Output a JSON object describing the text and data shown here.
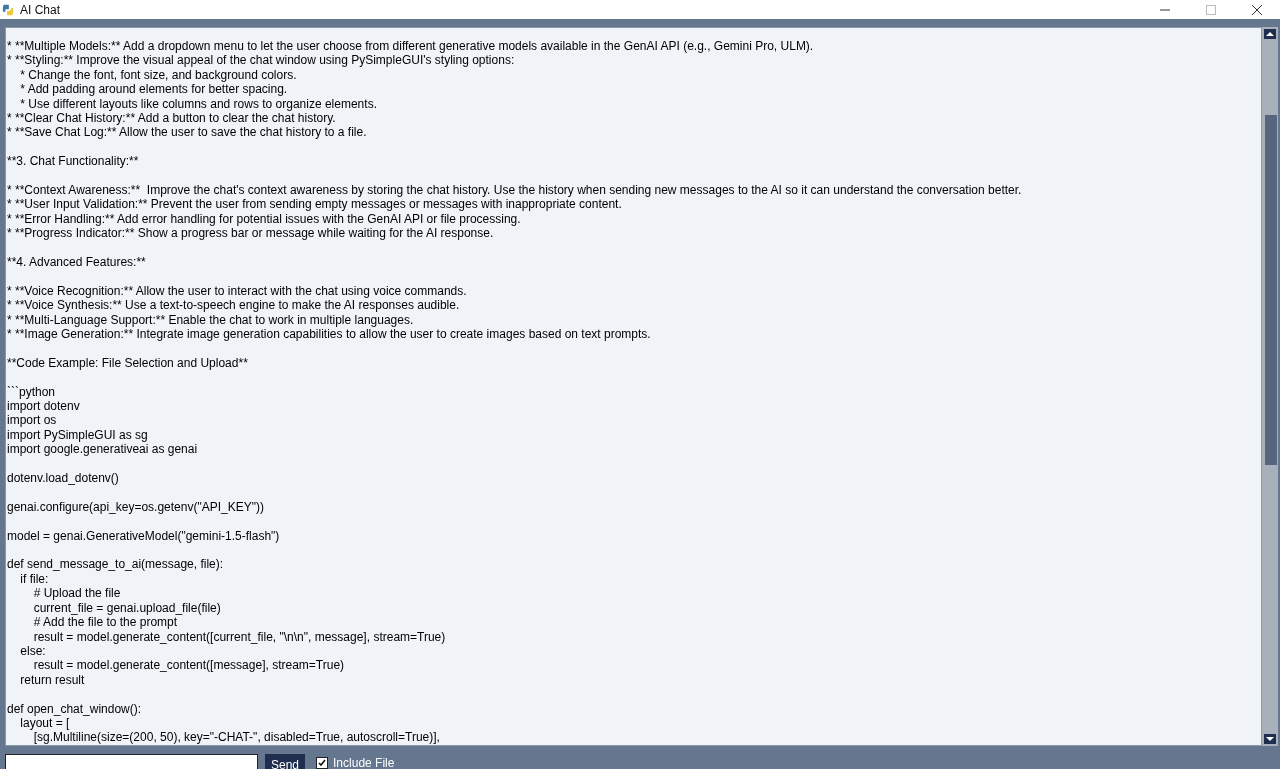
{
  "window": {
    "title": "AI Chat"
  },
  "chat": {
    "blocks": [
      [
        "* **Multiple Models:** Add a dropdown menu to let the user choose from different generative models available in the GenAI API (e.g., Gemini Pro, ULM).",
        "* **Styling:** Improve the visual appeal of the chat window using PySimpleGUI's styling options:",
        "    * Change the font, font size, and background colors.",
        "    * Add padding around elements for better spacing.",
        "    * Use different layouts like columns and rows to organize elements.",
        "* **Clear Chat History:** Add a button to clear the chat history.",
        "* **Save Chat Log:** Allow the user to save the chat history to a file."
      ],
      [
        "**3. Chat Functionality:**"
      ],
      [
        "* **Context Awareness:**  Improve the chat's context awareness by storing the chat history. Use the history when sending new messages to the AI so it can understand the conversation better.",
        "* **User Input Validation:** Prevent the user from sending empty messages or messages with inappropriate content.",
        "* **Error Handling:** Add error handling for potential issues with the GenAI API or file processing.",
        "* **Progress Indicator:** Show a progress bar or message while waiting for the AI response."
      ],
      [
        "**4. Advanced Features:**"
      ],
      [
        "* **Voice Recognition:** Allow the user to interact with the chat using voice commands.",
        "* **Voice Synthesis:** Use a text-to-speech engine to make the AI responses audible.",
        "* **Multi-Language Support:** Enable the chat to work in multiple languages.",
        "* **Image Generation:** Integrate image generation capabilities to allow the user to create images based on text prompts."
      ],
      [
        "**Code Example: File Selection and Upload**"
      ],
      [
        "```python",
        "import dotenv",
        "import os",
        "import PySimpleGUI as sg",
        "import google.generativeai as genai"
      ],
      [
        "dotenv.load_dotenv()"
      ],
      [
        "genai.configure(api_key=os.getenv(\"API_KEY\"))"
      ],
      [
        "model = genai.GenerativeModel(\"gemini-1.5-flash\")"
      ],
      [
        "def send_message_to_ai(message, file):",
        "    if file:",
        "        # Upload the file",
        "        current_file = genai.upload_file(file)",
        "        # Add the file to the prompt",
        "        result = model.generate_content([current_file, \"\\n\\n\", message], stream=True)",
        "    else:",
        "        result = model.generate_content([message], stream=True)",
        "    return result"
      ],
      [
        "def open_chat_window():",
        "    layout = [",
        "        [sg.Multiline(size=(200, 50), key=\"-CHAT-\", disabled=True, autoscroll=True)],"
      ]
    ]
  },
  "send_button": "Send",
  "include_file": {
    "label": "Include File",
    "checked": true
  }
}
